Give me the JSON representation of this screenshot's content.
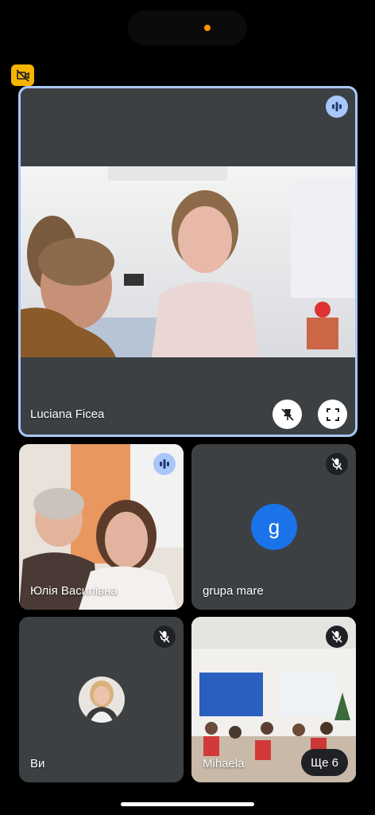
{
  "status": {
    "indicator_color": "#ff9500"
  },
  "camera_off_badge": {
    "icon": "camera-off-icon",
    "color": "#f5b400"
  },
  "main_tile": {
    "name": "Luciana Ficea",
    "speaking": true,
    "pin_button_icon": "unpin-icon",
    "fullscreen_button_icon": "fullscreen-icon",
    "border_color": "#a8c7fa"
  },
  "tiles": [
    {
      "name": "Юлія Василівна",
      "status_icon": "speaking-icon"
    },
    {
      "name": "grupa mare",
      "avatar_letter": "g",
      "avatar_color": "#1a73e8",
      "status_icon": "mic-off-icon"
    },
    {
      "name": "Ви",
      "status_icon": "mic-off-icon"
    },
    {
      "name": "Mihaela",
      "status_icon": "mic-off-icon"
    }
  ],
  "more_participants": {
    "label": "Ще 6"
  }
}
